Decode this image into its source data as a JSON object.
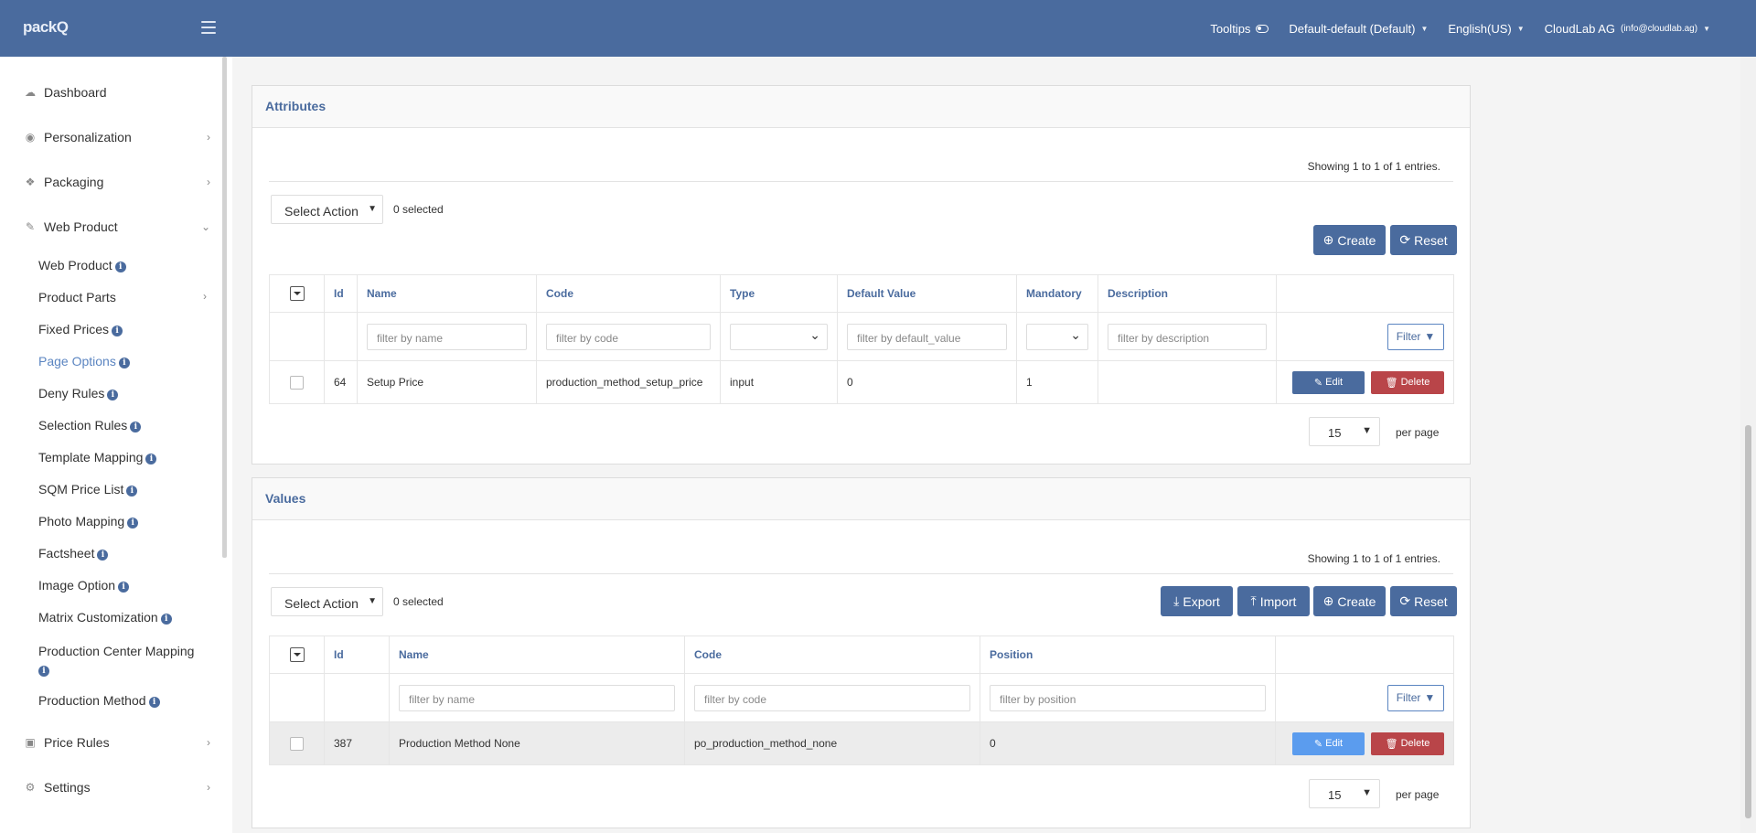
{
  "header": {
    "logo": "packQ",
    "tooltips_label": "Tooltips",
    "store": "Default-default (Default)",
    "language": "English(US)",
    "user_name": "CloudLab AG",
    "user_email": "(info@cloudlab.ag)"
  },
  "sidebar": {
    "top_items": [
      {
        "label": "Dashboard",
        "icon": "cloud-icon"
      },
      {
        "label": "Personalization",
        "icon": "eye-icon"
      },
      {
        "label": "Packaging",
        "icon": "dropbox-icon"
      },
      {
        "label": "Web Product",
        "icon": "magic-wand-icon"
      },
      {
        "label": "Price Rules",
        "icon": "money-icon"
      },
      {
        "label": "Settings",
        "icon": "cogs-icon"
      }
    ],
    "sub_items": [
      {
        "label": "Web Product"
      },
      {
        "label": "Product Parts"
      },
      {
        "label": "Fixed Prices"
      },
      {
        "label": "Page Options"
      },
      {
        "label": "Deny Rules"
      },
      {
        "label": "Selection Rules"
      },
      {
        "label": "Template Mapping"
      },
      {
        "label": "SQM Price List"
      },
      {
        "label": "Photo Mapping"
      },
      {
        "label": "Factsheet"
      },
      {
        "label": "Image Option"
      },
      {
        "label": "Matrix Customization"
      },
      {
        "label": "Production Center Mapping"
      },
      {
        "label": "Production Method"
      }
    ]
  },
  "attributes": {
    "title": "Attributes",
    "showing": "Showing 1 to 1 of 1 entries.",
    "select_action": "Select Action",
    "selected_count": "0 selected",
    "create": "Create",
    "reset": "Reset",
    "columns": [
      "Id",
      "Name",
      "Code",
      "Type",
      "Default Value",
      "Mandatory",
      "Description"
    ],
    "filters": {
      "name": "filter by name",
      "code": "filter by code",
      "default_value": "filter by default_value",
      "description": "filter by description"
    },
    "filter_button": "Filter",
    "row": {
      "id": "64",
      "name": "Setup Price",
      "code": "production_method_setup_price",
      "type": "input",
      "default_value": "0",
      "mandatory": "1",
      "description": ""
    },
    "edit": "Edit",
    "delete": "Delete",
    "per_page_value": "15",
    "per_page_label": "per page"
  },
  "values": {
    "title": "Values",
    "showing": "Showing 1 to 1 of 1 entries.",
    "select_action": "Select Action",
    "selected_count": "0 selected",
    "export": "Export",
    "import": "Import",
    "create": "Create",
    "reset": "Reset",
    "columns": [
      "Id",
      "Name",
      "Code",
      "Position"
    ],
    "filters": {
      "name": "filter by name",
      "code": "filter by code",
      "position": "filter by position"
    },
    "filter_button": "Filter",
    "row": {
      "id": "387",
      "name": "Production Method None",
      "code": "po_production_method_none",
      "position": "0"
    },
    "edit": "Edit",
    "delete": "Delete",
    "per_page_value": "15",
    "per_page_label": "per page"
  }
}
